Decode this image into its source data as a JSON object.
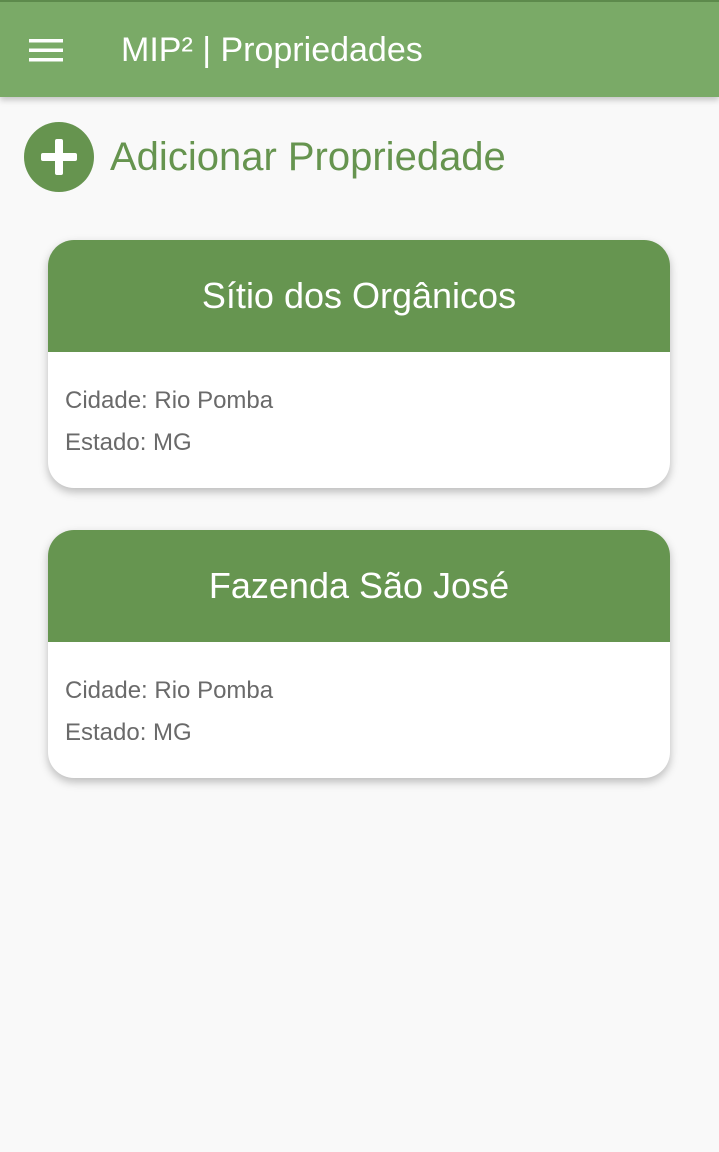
{
  "app_bar": {
    "menu_icon": "hamburger-menu-icon",
    "title": "MIP² | Propriedades",
    "color": "#7aaa67"
  },
  "add_action": {
    "icon": "plus-circle-icon",
    "label": "Adicionar Propriedade",
    "color": "#66944f"
  },
  "properties": [
    {
      "name": "Sítio dos Orgânicos",
      "city_line": "Cidade: Rio Pomba",
      "state_line": "Estado: MG"
    },
    {
      "name": "Fazenda São José",
      "city_line": "Cidade: Rio Pomba",
      "state_line": "Estado: MG"
    }
  ]
}
